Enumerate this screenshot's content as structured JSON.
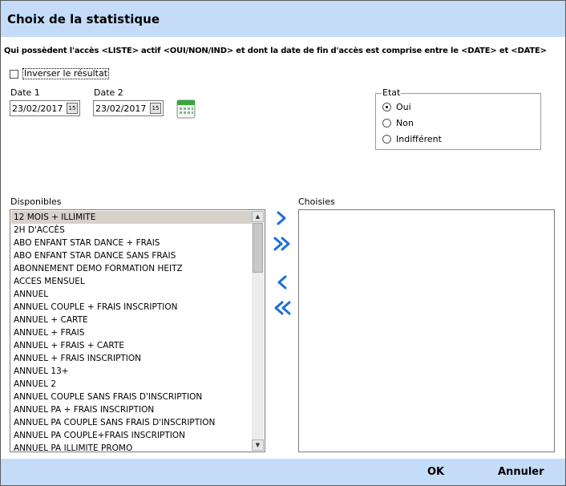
{
  "title": "Choix de la statistique",
  "description": "Qui possèdent l'accès <LISTE> actif <OUI/NON/IND> et dont la date de fin d'accès est comprise entre le <DATE> et <DATE>",
  "invert_label": "Inverser le résultat",
  "date1": {
    "label": "Date 1",
    "value": "23/02/2017"
  },
  "date2": {
    "label": "Date 2",
    "value": "23/02/2017"
  },
  "date_button_glyph": "15",
  "etat": {
    "legend": "Etat",
    "options": [
      {
        "label": "Oui",
        "selected": true
      },
      {
        "label": "Non",
        "selected": false
      },
      {
        "label": "Indifférent",
        "selected": false
      }
    ]
  },
  "available": {
    "label": "Disponibles",
    "items": [
      "12 MOIS + ILLIMITE",
      "2H D'ACCÈS",
      "ABO ENFANT STAR DANCE + FRAIS",
      "ABO ENFANT STAR DANCE SANS FRAIS",
      "ABONNEMENT DEMO FORMATION HEITZ",
      "ACCES MENSUEL",
      "ANNUEL",
      "ANNUEL  COUPLE + FRAIS INSCRIPTION",
      "ANNUEL + CARTE",
      "ANNUEL + FRAIS",
      "ANNUEL + FRAIS + CARTE",
      "ANNUEL + FRAIS INSCRIPTION",
      "ANNUEL 13+",
      "ANNUEL 2",
      "ANNUEL COUPLE SANS FRAIS D'INSCRIPTION",
      "ANNUEL PA + FRAIS INSCRIPTION",
      "ANNUEL PA COUPLE SANS FRAIS D'INSCRIPTION",
      "ANNUEL PA COUPLE+FRAIS INSCRIPTION",
      "ANNUEL PA ILLIMITE PROMO"
    ],
    "selected_index": 0
  },
  "chosen": {
    "label": "Choisies",
    "items": []
  },
  "footer": {
    "ok": "OK",
    "cancel": "Annuler"
  },
  "colors": {
    "header": "#c4dcf8",
    "arrow": "#1f6fd6",
    "selection": "#d7d1cc"
  }
}
